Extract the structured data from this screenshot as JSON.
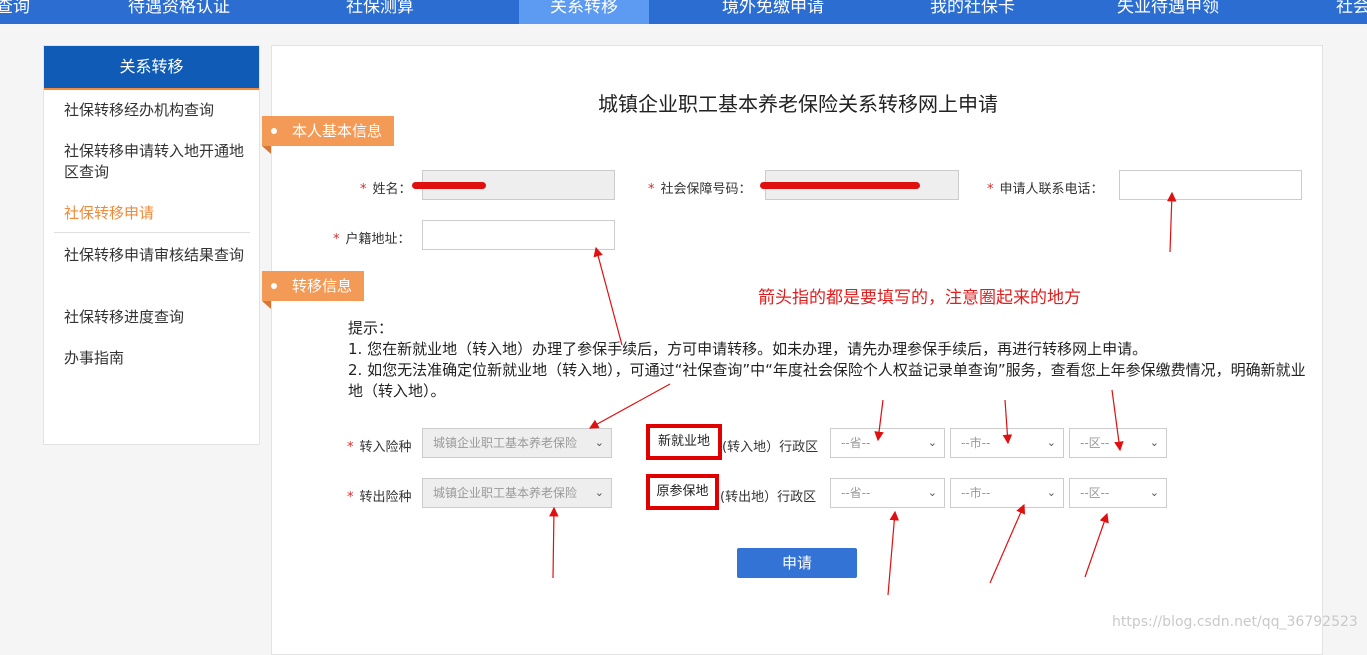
{
  "topnav": {
    "items": [
      "查询",
      "待遇资格认证",
      "社保测算",
      "关系转移",
      "境外免缴申请",
      "我的社保卡",
      "失业待遇申领",
      "社会"
    ],
    "active_index": 3
  },
  "sidebar": {
    "title": "关系转移",
    "items": [
      {
        "label": "社保转移经办机构查询"
      },
      {
        "label": "社保转移申请转入地开通地区查询"
      },
      {
        "label": "社保转移申请"
      },
      {
        "label": "社保转移申请审核结果查询"
      },
      {
        "label": "社保转移进度查询"
      },
      {
        "label": "办事指南"
      }
    ],
    "active_index": 2
  },
  "form": {
    "title": "城镇企业职工基本养老保险关系转移网上申请",
    "section_personal": "本人基本信息",
    "section_transfer": "转移信息",
    "required_mark": "*",
    "name_label": "姓名：",
    "ssn_label": "社会保障号码：",
    "phone_label": "申请人联系电话：",
    "address_label": "户籍地址：",
    "tips_title": "提示：",
    "tips_1": "1. 您在新就业地（转入地）办理了参保手续后，方可申请转移。如未办理，请先办理参保手续后，再进行转移网上申请。",
    "tips_2": "2. 如您无法准确定位新就业地（转入地），可通过“社保查询”中“年度社会保险个人权益记录单查询”服务，查看您上年参保缴费情况，明确新就业地（转入地）。",
    "in_type_label": "转入险种",
    "out_type_label": "转出险种",
    "insurance_type": "城镇企业职工基本养老保险",
    "in_place_boxed": "新就业地",
    "in_place_rest": "(转入地）行政区",
    "out_place_boxed": "原参保地",
    "out_place_rest": "(转出地）行政区",
    "province_placeholder": "--省--",
    "city_placeholder": "--市--",
    "district_placeholder": "--区--",
    "submit_label": "申请"
  },
  "annotation": {
    "note": "箭头指的都是要填写的，注意圈起来的地方",
    "color": "#e01e1e"
  },
  "watermark": "https://blog.csdn.net/qq_36792523"
}
